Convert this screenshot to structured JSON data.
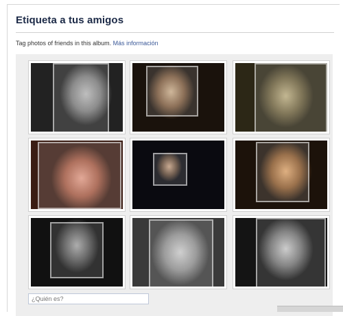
{
  "dialog": {
    "title": "Etiqueta a tus amigos",
    "description": "Tag photos of friends in this album.",
    "more_info_link": "Más información",
    "input_placeholder": "¿Quién es?"
  },
  "colors": {
    "title": "#1c2a47",
    "link": "#3b5998",
    "panel_bg": "#eeeeee",
    "input_border": "#bdc7d8"
  },
  "photos": [
    {
      "name": "face-photo-1",
      "tone": "grayscale"
    },
    {
      "name": "face-photo-2",
      "tone": "sepia-dark"
    },
    {
      "name": "face-photo-3",
      "tone": "olive-sepia"
    },
    {
      "name": "face-photo-4",
      "tone": "warm-red"
    },
    {
      "name": "face-photo-5",
      "tone": "dark-night"
    },
    {
      "name": "face-photo-6",
      "tone": "warm-color"
    },
    {
      "name": "face-photo-7",
      "tone": "grayscale-dark"
    },
    {
      "name": "face-photo-8",
      "tone": "grayscale-light"
    },
    {
      "name": "face-photo-9",
      "tone": "grayscale-contrast"
    }
  ]
}
